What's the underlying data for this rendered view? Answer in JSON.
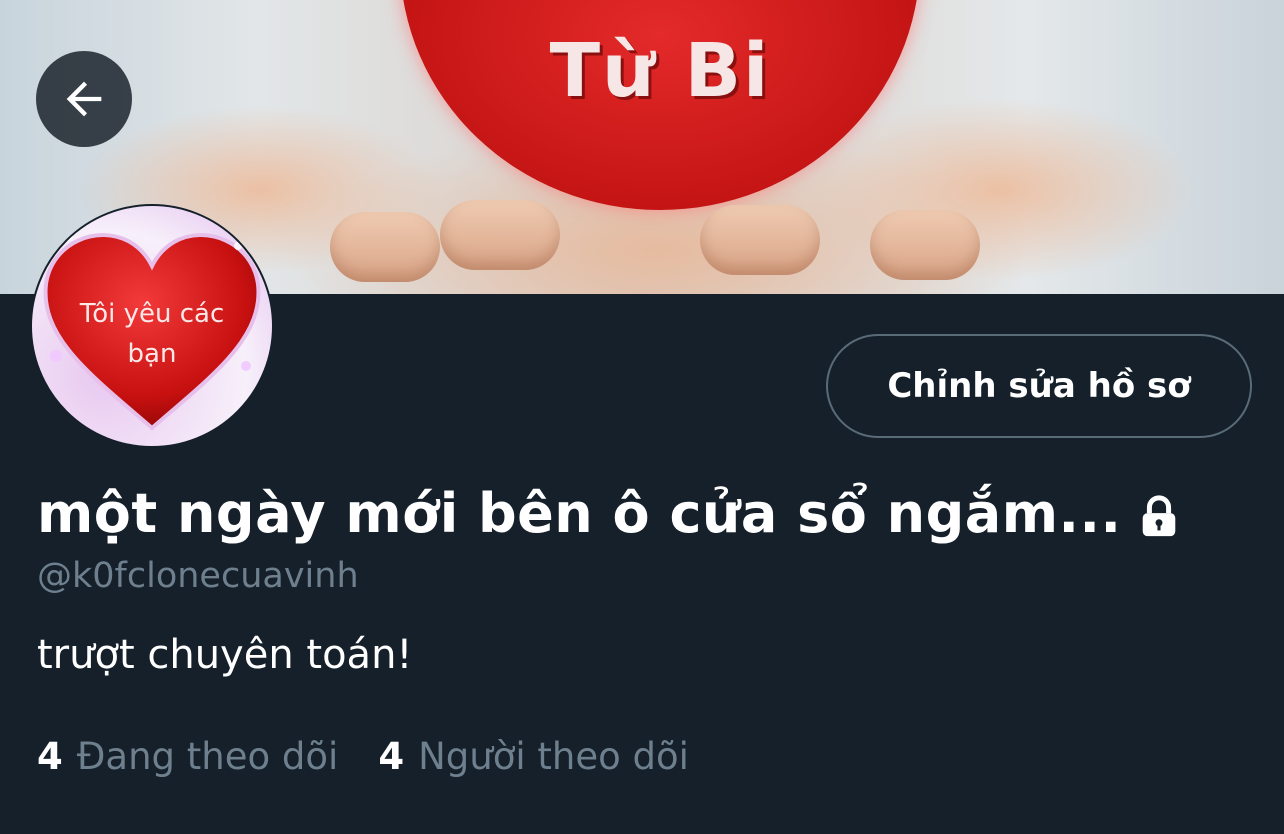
{
  "banner": {
    "text": "Từ Bi"
  },
  "avatar": {
    "text": "Tôi yêu các bạn"
  },
  "back_button": {
    "icon": "arrow-left-icon"
  },
  "edit_profile": {
    "label": "Chỉnh sửa hồ sơ"
  },
  "profile": {
    "display_name": "một ngày mới bên ô cửa sổ ngắm...",
    "lock_icon": "lock-icon",
    "handle": "@k0fclonecuavinh",
    "bio": "trượt chuyên toán!"
  },
  "stats": {
    "following_count": "4",
    "following_label": "Đang theo dõi",
    "followers_count": "4",
    "followers_label": "Người theo dõi"
  },
  "colors": {
    "background": "#15202b",
    "muted_text": "#6e7f8d",
    "button_border": "#5a6b78"
  }
}
